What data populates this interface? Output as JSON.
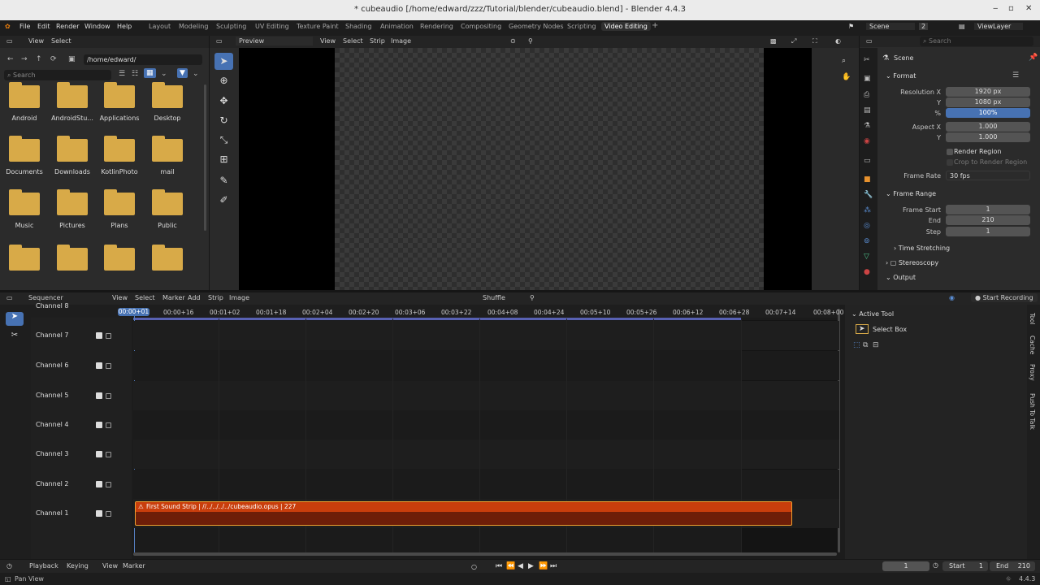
{
  "window": {
    "title": "* cubeaudio [/home/edward/zzz/Tutorial/blender/cubeaudio.blend] - Blender 4.4.3"
  },
  "menus": [
    "File",
    "Edit",
    "Render",
    "Window",
    "Help"
  ],
  "workspaces": [
    "Layout",
    "Modeling",
    "Sculpting",
    "UV Editing",
    "Texture Paint",
    "Shading",
    "Animation",
    "Rendering",
    "Compositing",
    "Geometry Nodes",
    "Scripting",
    "Video Editing"
  ],
  "active_workspace": "Video Editing",
  "scene": {
    "name": "Scene",
    "count": "2",
    "view_layer": "ViewLayer"
  },
  "file_browser": {
    "view_label": "View",
    "select_label": "Select",
    "path": "/home/edward/",
    "search_placeholder": "Search",
    "folders": [
      {
        "name": "Android"
      },
      {
        "name": "AndroidStu..."
      },
      {
        "name": "Applications"
      },
      {
        "name": "Desktop"
      },
      {
        "name": "Documents"
      },
      {
        "name": "Downloads"
      },
      {
        "name": "KotlinPhoto"
      },
      {
        "name": "mail"
      },
      {
        "name": "Music"
      },
      {
        "name": "Pictures"
      },
      {
        "name": "Plans"
      },
      {
        "name": "Public"
      },
      {
        "name": ""
      },
      {
        "name": ""
      },
      {
        "name": ""
      },
      {
        "name": ""
      }
    ]
  },
  "preview": {
    "mode": "Preview",
    "menus": [
      "View",
      "Select",
      "Strip",
      "Image"
    ]
  },
  "properties": {
    "search_placeholder": "Search",
    "scene_name": "Scene",
    "format_label": "Format",
    "resolution_x_label": "Resolution X",
    "resolution_x": "1920 px",
    "resolution_y_label": "Y",
    "resolution_y": "1080 px",
    "percent_label": "%",
    "percent": "100%",
    "aspect_x_label": "Aspect X",
    "aspect_x": "1.000",
    "aspect_y_label": "Y",
    "aspect_y": "1.000",
    "render_region": "Render Region",
    "crop_region": "Crop to Render Region",
    "frame_rate_label": "Frame Rate",
    "frame_rate": "30 fps",
    "frame_range_label": "Frame Range",
    "frame_start_label": "Frame Start",
    "frame_start": "1",
    "frame_end_label": "End",
    "frame_end": "210",
    "frame_step_label": "Step",
    "frame_step": "1",
    "time_stretching": "Time Stretching",
    "stereoscopy": "Stereoscopy",
    "output": "Output"
  },
  "sequencer": {
    "editor": "Sequencer",
    "menus": [
      "View",
      "Select",
      "Marker",
      "Add",
      "Strip",
      "Image"
    ],
    "overlap_mode": "Shuffle",
    "start_recording": "Start Recording",
    "current_time": "00:00+01",
    "ticks": [
      "00:00+16",
      "00:01+02",
      "00:01+18",
      "00:02+04",
      "00:02+20",
      "00:03+06",
      "00:03+22",
      "00:04+08",
      "00:04+24",
      "00:05+10",
      "00:05+26",
      "00:06+12",
      "00:06+28",
      "00:07+14",
      "00:08+00"
    ],
    "channels": [
      "Channel 8",
      "Channel 7",
      "Channel 6",
      "Channel 5",
      "Channel 4",
      "Channel 3",
      "Channel 2",
      "Channel 1"
    ],
    "strip": {
      "label": "First Sound Strip | //../../../../cubeaudio.opus | 227",
      "color": "#c93e0c"
    },
    "active_tool_label": "Active Tool",
    "tool_name": "Select Box",
    "side_tabs": [
      "Tool",
      "Cache",
      "Proxy",
      "Push To Talk"
    ]
  },
  "timeline": {
    "menus": [
      "Playback",
      "Keying",
      "View",
      "Marker"
    ],
    "current_frame": "1",
    "start_label": "Start",
    "start": "1",
    "end_label": "End",
    "end": "210"
  },
  "status": {
    "text": "Pan View",
    "version": "4.4.3"
  },
  "colors": {
    "accent": "#4772b3",
    "folder": "#d8aa48",
    "strip": "#c93e0c",
    "playhead": "#5680c2"
  }
}
